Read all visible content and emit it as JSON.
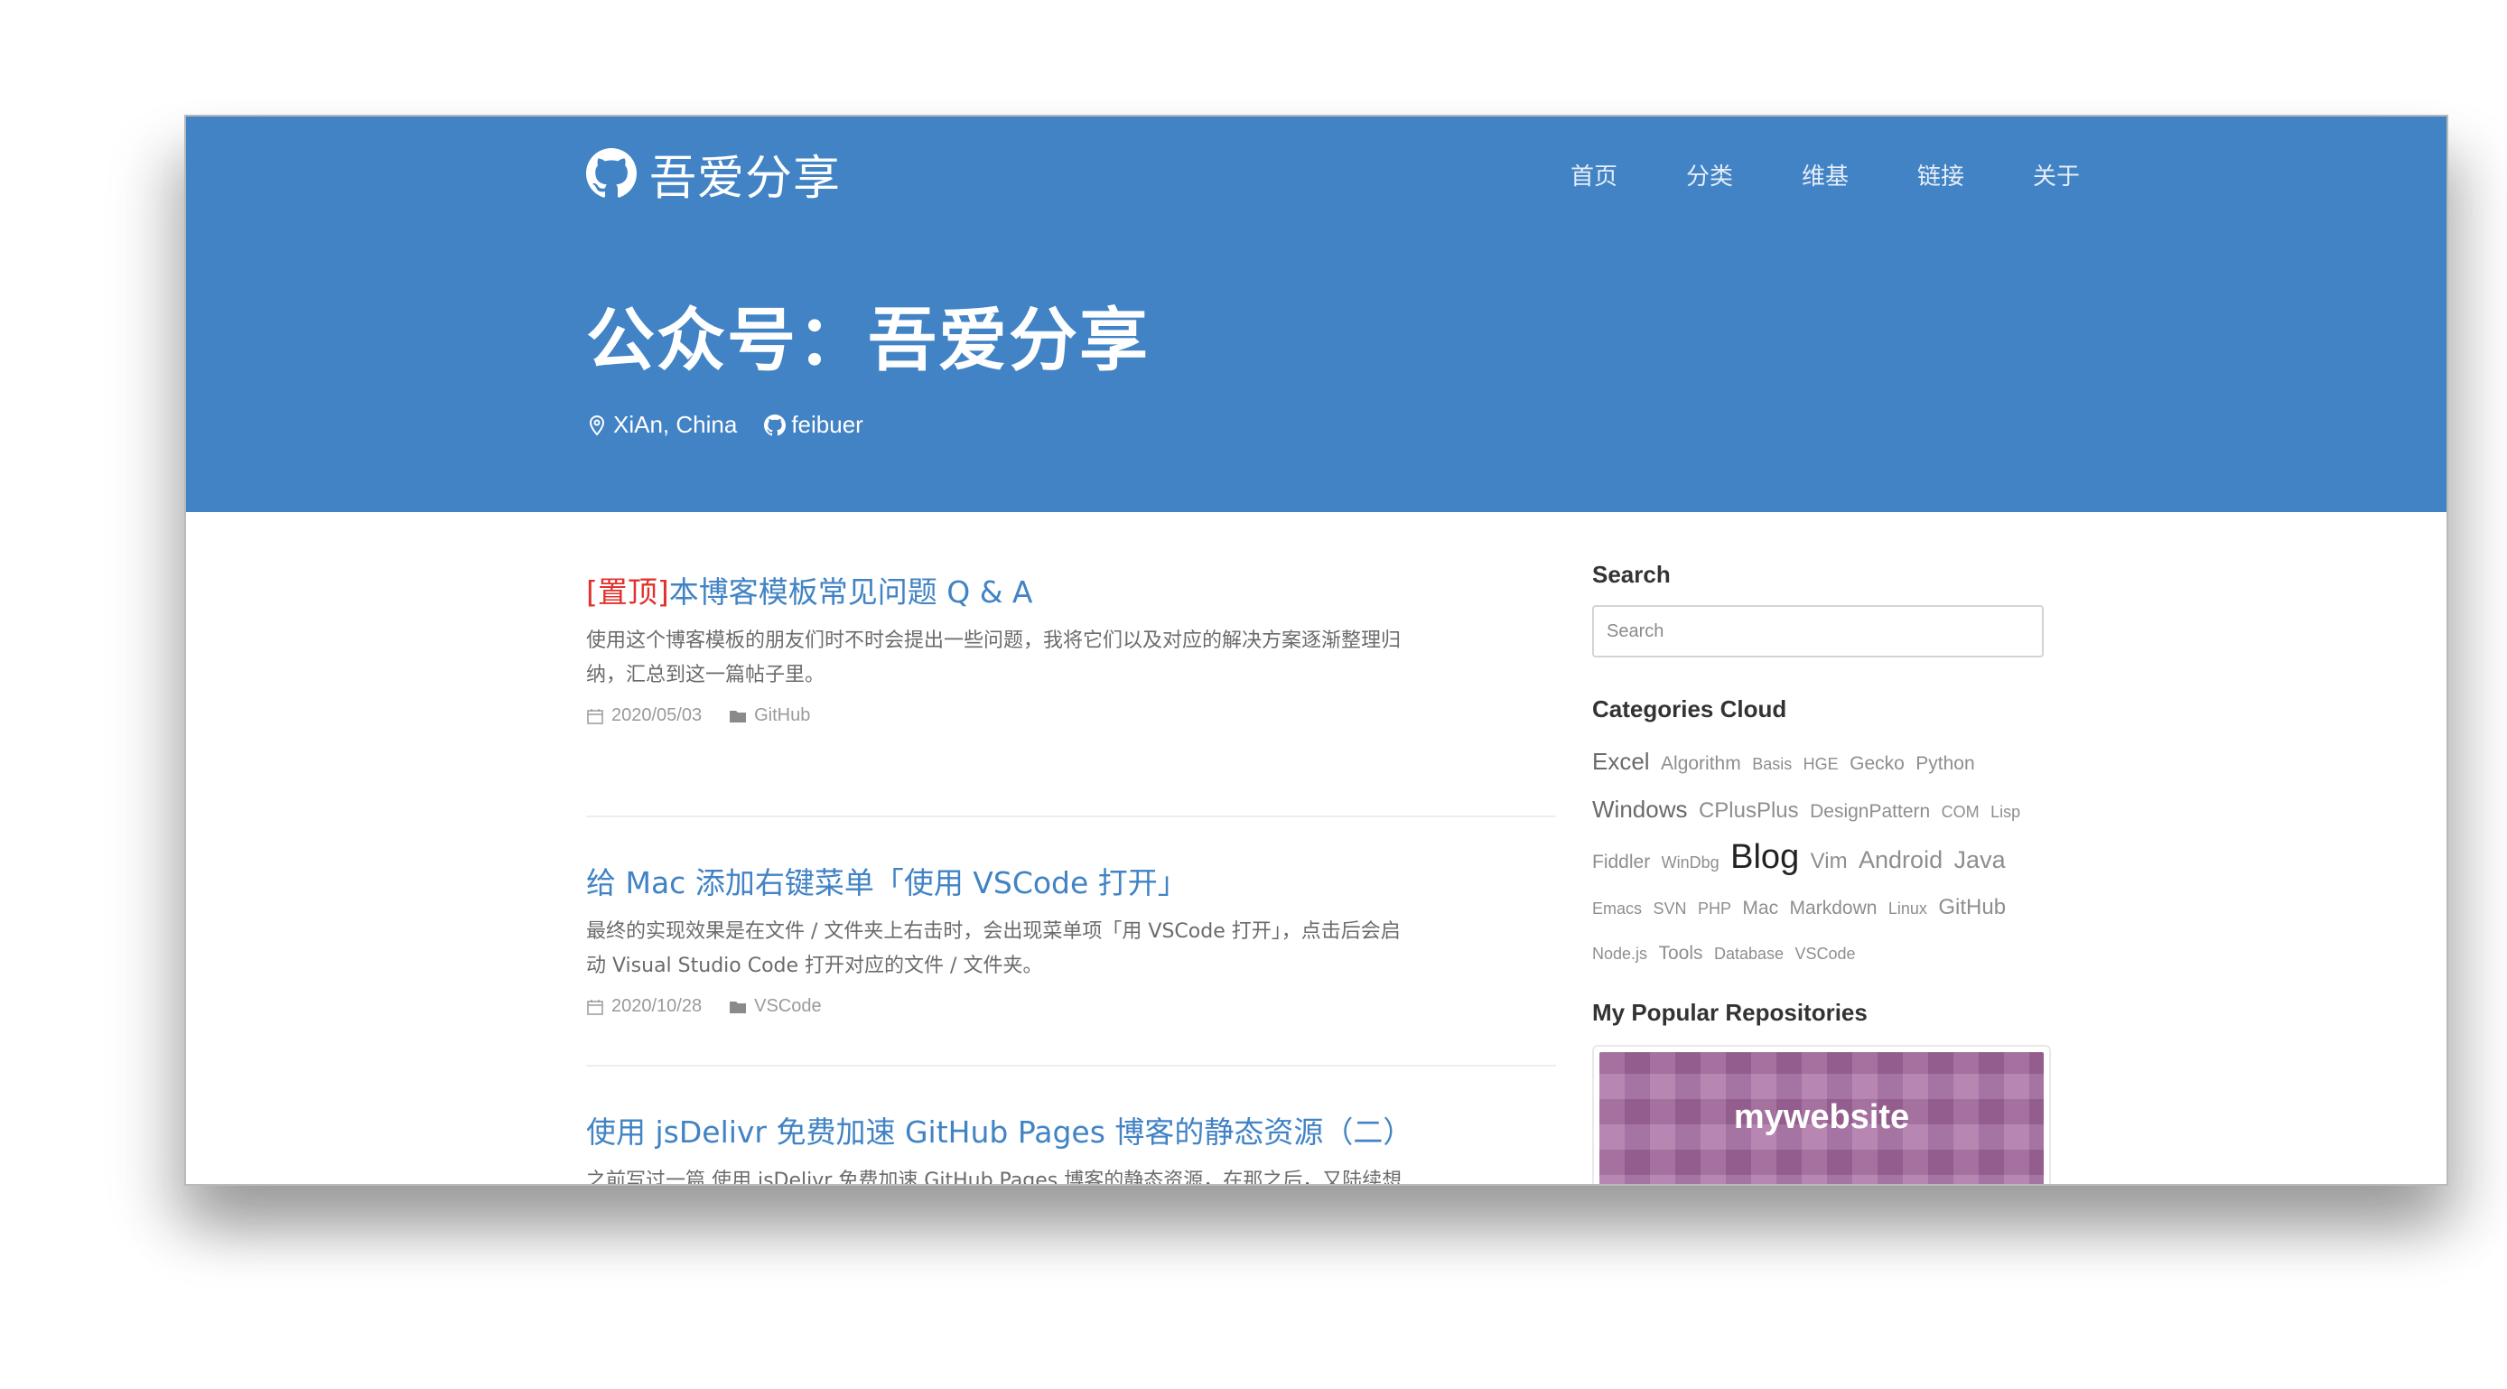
{
  "brand": {
    "name": "吾爱分享",
    "icon": "github-icon"
  },
  "nav": [
    "首页",
    "分类",
    "维基",
    "链接",
    "关于"
  ],
  "hero": {
    "title": "公众号：吾爱分享",
    "location": "XiAn, China",
    "github_user": "feibuer"
  },
  "posts": [
    {
      "pin": "[置顶]",
      "title": "本博客模板常见问题 Q & A",
      "excerpt": "使用这个博客模板的朋友们时不时会提出一些问题，我将它们以及对应的解决方案逐渐整理归纳，汇总到这一篇帖子里。",
      "date": "2020/05/03",
      "category": "GitHub"
    },
    {
      "pin": "",
      "title": "给 Mac 添加右键菜单「使用 VSCode 打开」",
      "excerpt": "最终的实现效果是在文件 / 文件夹上右击时，会出现菜单项「用 VSCode 打开」，点击后会启动 Visual Studio Code 打开对应的文件 / 文件夹。",
      "date": "2020/10/28",
      "category": "VSCode"
    },
    {
      "pin": "",
      "title": "使用 jsDelivr 免费加速 GitHub Pages 博客的静态资源（二）",
      "excerpt": "之前写过一篇 使用 jsDelivr 免费加速 GitHub Pages 博客的静态资源，在那之后，又陆续想到并实施了几点利用 jsDelivr 进一步加速静态资源加载的措施，新起一篇作为记录和分",
      "date": "",
      "category": ""
    }
  ],
  "sidebar": {
    "search_heading": "Search",
    "search_placeholder": "Search",
    "categories_heading": "Categories Cloud",
    "categories": [
      {
        "label": "Excel",
        "size": "s3b"
      },
      {
        "label": "Algorithm",
        "size": "s2"
      },
      {
        "label": "Basis",
        "size": "s1"
      },
      {
        "label": "HGE",
        "size": "s1"
      },
      {
        "label": "Gecko",
        "size": "s2"
      },
      {
        "label": "Python",
        "size": "s2"
      },
      {
        "label": "Windows",
        "size": "s3b"
      },
      {
        "label": "CPlusPlus",
        "size": "s3"
      },
      {
        "label": "DesignPattern",
        "size": "s2"
      },
      {
        "label": "COM",
        "size": "s1"
      },
      {
        "label": "Lisp",
        "size": "s1"
      },
      {
        "label": "Fiddler",
        "size": "s2"
      },
      {
        "label": "WinDbg",
        "size": "s1"
      },
      {
        "label": "Blog",
        "size": "s5"
      },
      {
        "label": "Vim",
        "size": "s3"
      },
      {
        "label": "Android",
        "size": "s4"
      },
      {
        "label": "Java",
        "size": "s4"
      },
      {
        "label": "Emacs",
        "size": "s1"
      },
      {
        "label": "SVN",
        "size": "s1"
      },
      {
        "label": "PHP",
        "size": "s1"
      },
      {
        "label": "Mac",
        "size": "s2"
      },
      {
        "label": "Markdown",
        "size": "s2"
      },
      {
        "label": "Linux",
        "size": "s1"
      },
      {
        "label": "GitHub",
        "size": "s3"
      },
      {
        "label": "Node.js",
        "size": "s1"
      },
      {
        "label": "Tools",
        "size": "s2"
      },
      {
        "label": "Database",
        "size": "s1"
      },
      {
        "label": "VSCode",
        "size": "s1"
      }
    ],
    "repos_heading": "My Popular Repositories",
    "repo_name": "mywebsite"
  }
}
